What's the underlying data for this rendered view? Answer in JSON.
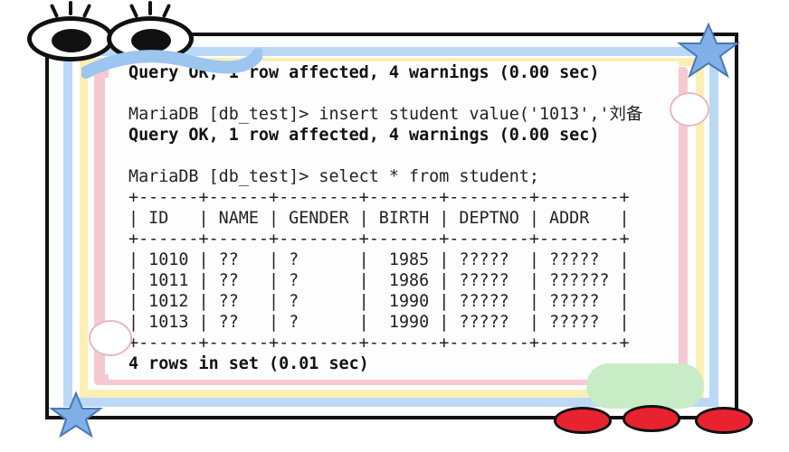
{
  "terminal": {
    "lines": [
      {
        "text": "Query OK, 1 row affected, 4 warnings (0.00 sec)",
        "bold": true
      },
      {
        "text": "",
        "bold": false
      },
      {
        "text": "MariaDB [db_test]> insert student value('1013','刘备",
        "bold": false
      },
      {
        "text": "Query OK, 1 row affected, 4 warnings (0.00 sec)",
        "bold": true
      },
      {
        "text": "",
        "bold": false
      },
      {
        "text": "MariaDB [db_test]> select * from student;",
        "bold": false
      },
      {
        "text": "+------+------+--------+-------+--------+--------+",
        "bold": false
      },
      {
        "text": "| ID   | NAME | GENDER | BIRTH | DEPTNO | ADDR   |",
        "bold": false
      },
      {
        "text": "+------+------+--------+-------+--------+--------+",
        "bold": false
      },
      {
        "text": "| 1010 | ??   | ?      |  1985 | ?????  | ?????  |",
        "bold": false
      },
      {
        "text": "| 1011 | ??   | ?      |  1986 | ?????  | ?????? |",
        "bold": false
      },
      {
        "text": "| 1012 | ??   | ?      |  1990 | ?????  | ?????  |",
        "bold": false
      },
      {
        "text": "| 1013 | ??   | ?      |  1990 | ?????  | ?????  |",
        "bold": false
      },
      {
        "text": "+------+------+--------+-------+--------+--------+",
        "bold": false
      },
      {
        "text": "4 rows in set (0.01 sec)",
        "bold": true
      }
    ]
  },
  "colors": {
    "frame_border": "#111111",
    "stripe_blue": "#bcd8f7",
    "stripe_yellow": "#fbefb4",
    "stripe_pink": "#f6c9d2",
    "heart": "#e8232f",
    "star": "#7fb0e8"
  },
  "decor": {
    "icons": [
      "cartoon-eyes-icon",
      "star-icon",
      "cloud-face-icon",
      "heart-icon",
      "green-cloud-icon"
    ]
  }
}
